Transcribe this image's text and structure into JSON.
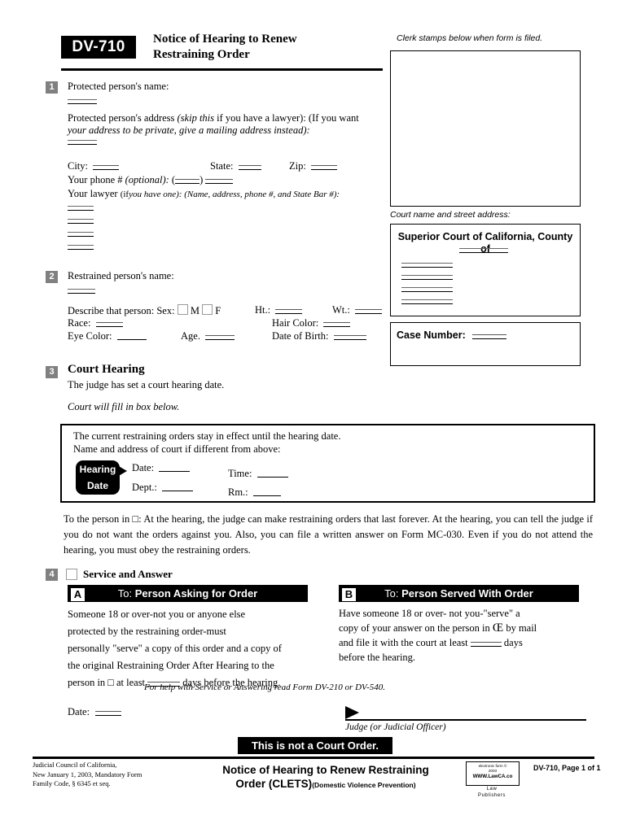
{
  "header": {
    "form_number": "DV-710",
    "title_line1": "Notice of Hearing to Renew",
    "title_line2": "Restraining Order"
  },
  "right_column": {
    "clerk_caption": "Clerk stamps below when form is filed.",
    "court_caption": "Court name and street address:",
    "court_title": "Superior Court of California, County of",
    "case_number_label": "Case Number:"
  },
  "section1": {
    "number": "1",
    "protected_name_label": "Protected person's name:",
    "address_label": "Protected person's address",
    "address_note1": "(skip this",
    "address_note2": "if you have a lawyer): (If you want",
    "address_note3": "your address to be private, give a mailing address instead):",
    "city_label": "City:",
    "state_label": "State:",
    "zip_label": "Zip:",
    "phone_label": "Your phone #",
    "phone_note": "(optional):",
    "lawyer_label": "Your lawyer",
    "lawyer_note1": "(if",
    "lawyer_note2": "you have one): (Name, address, phone #, and State Bar #):"
  },
  "section2": {
    "number": "2",
    "restrained_name_label": "Restrained person's name:",
    "describe_label": "Describe that person: Sex:",
    "sex_male": "M",
    "sex_female": "F",
    "height_label": "Ht.:",
    "weight_label": "Wt.:",
    "race_label": "Race:",
    "hair_label": "Hair Color:",
    "eye_label": "Eye Color:",
    "age_label": "Age.",
    "dob_label": "Date of Birth:"
  },
  "section3": {
    "number": "3",
    "heading": "Court Hearing",
    "subtitle": "The judge has set a court hearing date.",
    "fill_note": "Court will fill in box below.",
    "box_line1": "The current restraining orders stay in effect until the hearing date.",
    "box_line2": "Name and address of court if different from above:",
    "badge_line1": "Hearing",
    "badge_line2": "Date",
    "date_label": "Date:",
    "dept_label": "Dept.:",
    "time_label": "Time:",
    "room_label": "Rm.:",
    "notice_paragraph": "To the person in □: At the hearing, the judge can make restraining orders that last forever. At the hearing, you can tell the judge if you do not want the orders against you. Also, you can file a written answer on Form MC-030. Even if you do not attend the hearing, you must obey the restraining orders."
  },
  "section4": {
    "number": "4",
    "heading": "Service and Answer",
    "column_a": {
      "badge": "A",
      "bar_prefix": "To: ",
      "bar_title": "Person Asking for Order",
      "line1": "Someone 18 or over-not you or anyone else",
      "line2": "protected by the restraining order-must",
      "line3": "personally \"serve\" a copy of this order and a copy of",
      "line4": "the original Restraining Order After Hearing to the",
      "line5_pre": "person in □ at least",
      "line5_post": "days before the hearing."
    },
    "column_b": {
      "badge": "B",
      "bar_prefix": "To: ",
      "bar_title": "Person Served With Order",
      "line1": "Have someone 18 or over- not you-\"serve\" a",
      "line2_pre": "copy of your answer on the person in",
      "line2_mark": "Œ",
      "line2_post": "by mail",
      "line3_pre": "and file it with the court at least",
      "line3_post": "days",
      "line4": "before the hearing."
    },
    "help_note": "For help with Service or Answering read Form DV-210 or DV-540.",
    "date_label": "Date:",
    "judge_label": "Judge (or Judicial Officer)"
  },
  "footer": {
    "not_court_order": "This is not a Court Order.",
    "left_line1": "Judicial Council of California,",
    "left_line2": "New January 1, 2003, Mandatory Form",
    "left_line3": "Family Code, § 6345 et seq.",
    "center_line1": "Notice of Hearing to Renew Restraining",
    "center_line2": "Order (CLETS)",
    "center_sub": "(Domestic Violence Prevention)",
    "stamp_line1": "electronic form ©",
    "stamp_line2": "2003",
    "stamp_url": "WWW.LawCA.co",
    "stamp_sub1": "Law",
    "stamp_sub2": "Publishers",
    "page_info": "DV-710, Page 1 of 1"
  }
}
